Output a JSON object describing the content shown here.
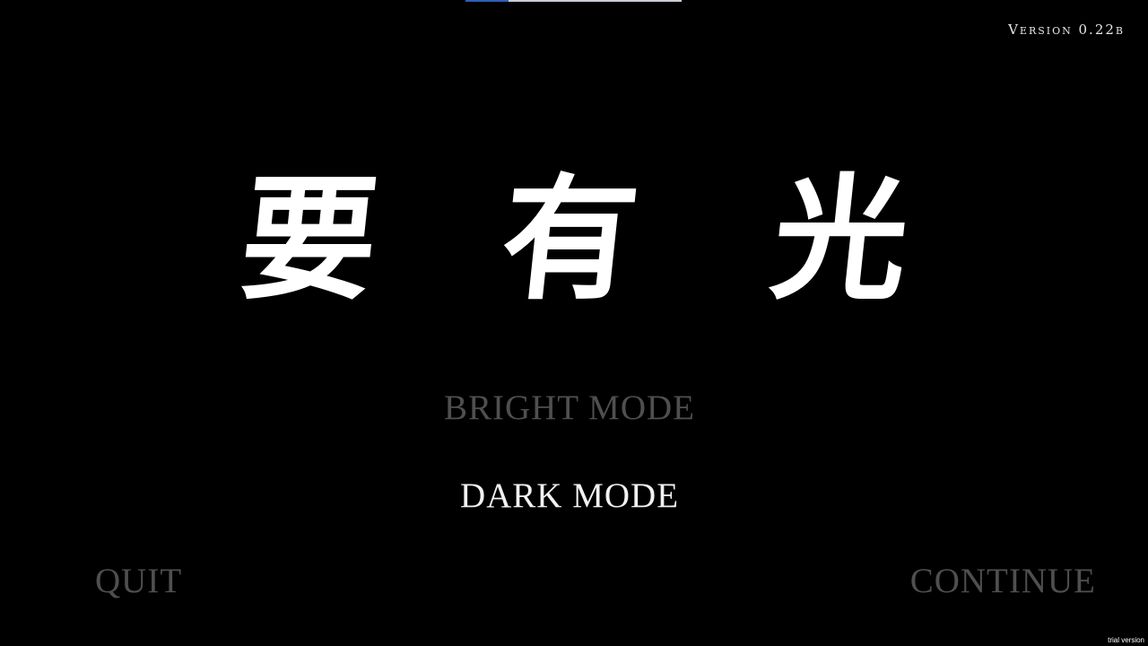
{
  "window": {
    "version": "Version 0.22b",
    "trial_label": "trial version",
    "top_bar_progress": 0.2
  },
  "title": {
    "chars": [
      "要",
      "有",
      "光"
    ]
  },
  "menu": {
    "bright_mode": "BRIGHT MODE",
    "dark_mode": "DARK MODE",
    "quit": "QUIT",
    "continue": "CONTINUE"
  },
  "colors": {
    "background": "#000000",
    "selected": "#f2f2f2",
    "unselected": "#4f4f4f",
    "bar": "#c9cdd6",
    "bar_fill": "#2f5fb8"
  }
}
